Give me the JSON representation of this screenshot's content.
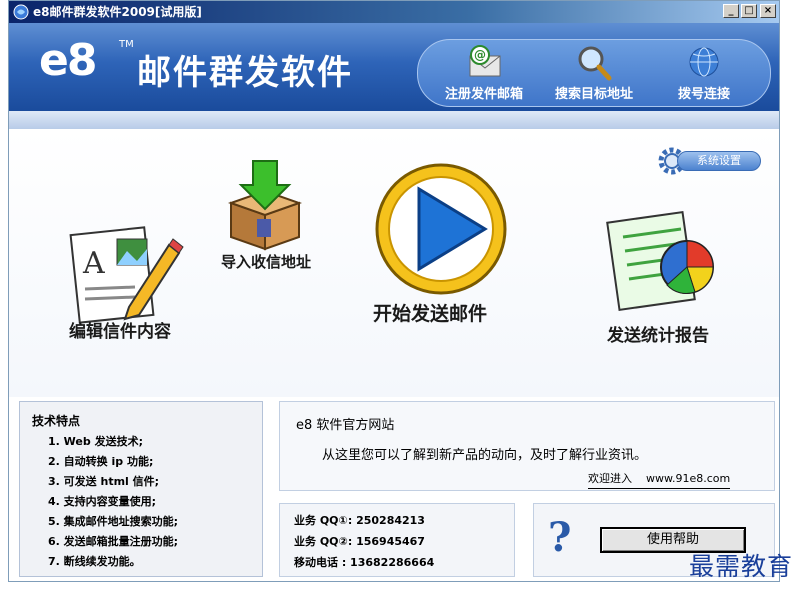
{
  "window": {
    "title": "e8邮件群发软件2009[试用版]",
    "min_glyph": "_",
    "max_glyph": "□",
    "close_glyph": "×"
  },
  "header": {
    "logo_mark": "e8",
    "logo_tm": "TM",
    "logo_title": "邮件群发软件",
    "nav": [
      {
        "label": "注册发件邮箱",
        "icon": "email-register-icon"
      },
      {
        "label": "搜索目标地址",
        "icon": "search-magnifier-icon"
      },
      {
        "label": "拨号连接",
        "icon": "globe-dialup-icon"
      }
    ]
  },
  "main": {
    "settings_label": "系统设置",
    "actions": {
      "edit": "编辑信件内容",
      "import": "导入收信地址",
      "start": "开始发送邮件",
      "report": "发送统计报告"
    }
  },
  "features": {
    "title": "技术特点",
    "items": [
      "1. Web 发送技术;",
      "2. 自动转换 ip 功能;",
      "3. 可发送 html 信件;",
      "4. 支持内容变量使用;",
      "5. 集成邮件地址搜索功能;",
      "6. 发送邮箱批量注册功能;",
      "7. 断线续发功能。"
    ]
  },
  "site": {
    "title": "e8 软件官方网站",
    "description": "从这里您可以了解到新产品的动向，及时了解行业资讯。",
    "link_text": "欢迎进入    www.91e8.com"
  },
  "contact": {
    "rows": [
      "业务 QQ①:  250284213",
      "业务 QQ②:  156945467",
      "移动电话 :  13682286664"
    ]
  },
  "help": {
    "icon_glyph": "?",
    "button_label": "使用帮助"
  },
  "watermark": "最需教育",
  "colors": {
    "header_blue": "#2e64b8",
    "accent_blue": "#1a3f9a"
  }
}
